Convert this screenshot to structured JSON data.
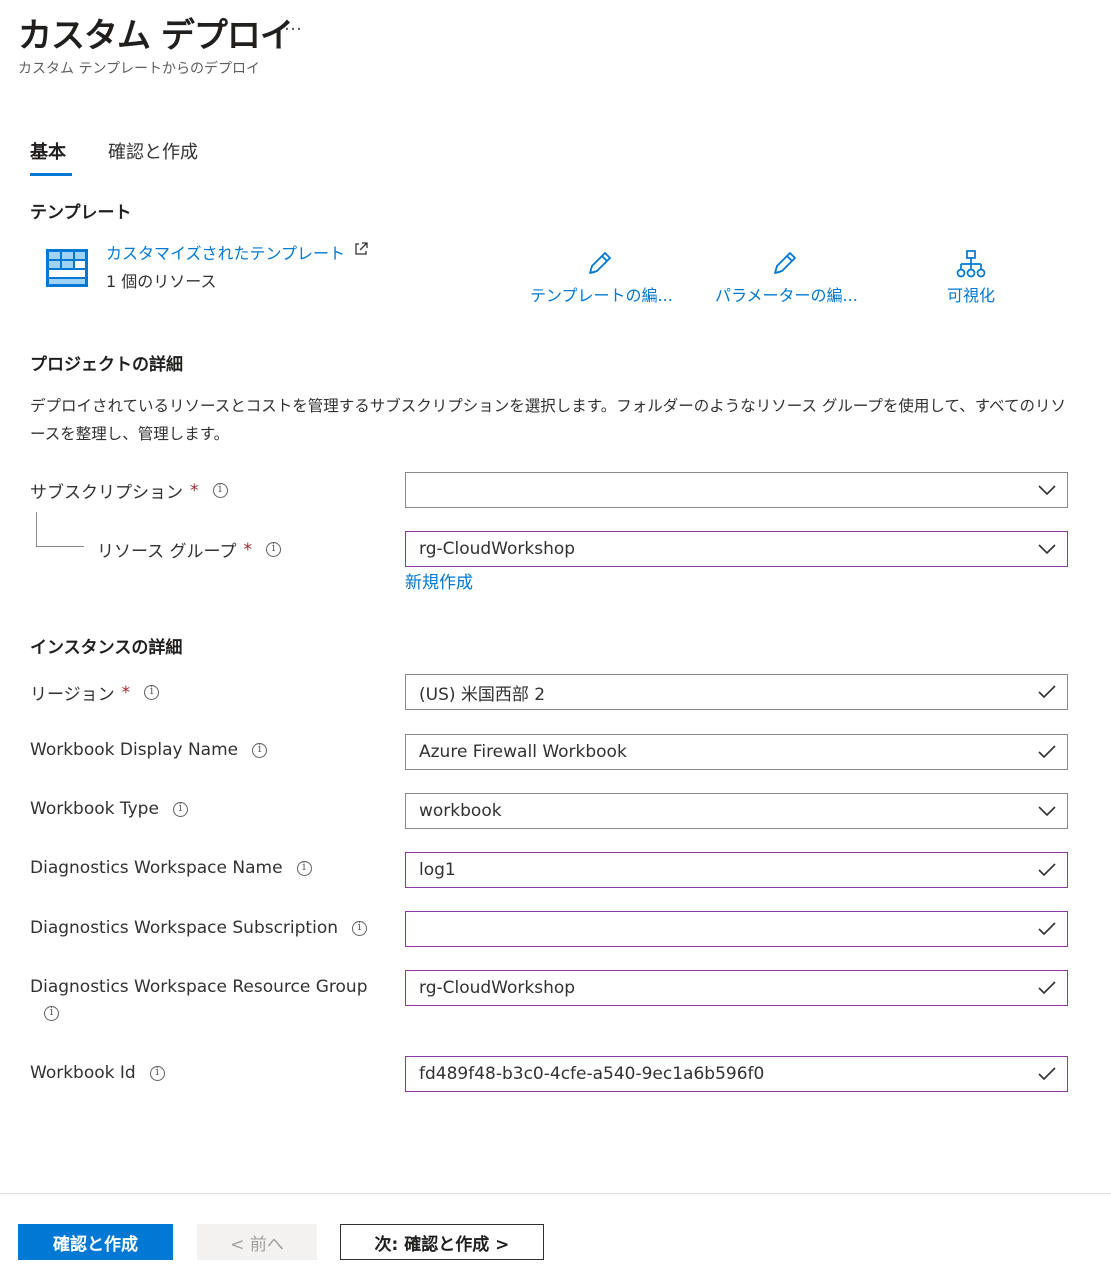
{
  "header": {
    "title": "カスタム デプロイ",
    "more": "…",
    "subtitle": "カスタム テンプレートからのデプロイ"
  },
  "tabs": [
    {
      "label": "基本",
      "active": true
    },
    {
      "label": "確認と作成",
      "active": false
    }
  ],
  "template_section": {
    "heading": "テンプレート",
    "link": "カスタマイズされたテンプレート",
    "resource_count": "1 個のリソース",
    "actions": [
      {
        "label": "テンプレートの編...",
        "icon": "pencil-icon"
      },
      {
        "label": "パラメーターの編...",
        "icon": "pencil-icon"
      },
      {
        "label": "可視化",
        "icon": "hierarchy-icon"
      }
    ]
  },
  "project_section": {
    "heading": "プロジェクトの詳細",
    "description": "デプロイされているリソースとコストを管理するサブスクリプションを選択します。フォルダーのようなリソース グループを使用して、すべてのリソースを整理し、管理します。",
    "subscription": {
      "label": "サブスクリプション",
      "required": "*",
      "value": ""
    },
    "resource_group": {
      "label": "リソース グループ",
      "required": "*",
      "value": "rg-CloudWorkshop"
    },
    "new_link": "新規作成"
  },
  "instance_section": {
    "heading": "インスタンスの詳細",
    "fields": [
      {
        "label": "リージョン",
        "required": "*",
        "value": "(US) 米国西部 2",
        "icon": "checkmark-icon"
      },
      {
        "label": "Workbook Display Name",
        "value": "Azure Firewall Workbook",
        "icon": "checkmark-icon"
      },
      {
        "label": "Workbook Type",
        "value": "workbook",
        "icon": "chevron-down-icon"
      },
      {
        "label": "Diagnostics Workspace Name",
        "value": "log1",
        "icon": "checkmark-icon"
      },
      {
        "label": "Diagnostics Workspace Subscription",
        "value": "",
        "icon": "checkmark-icon"
      },
      {
        "label": "Diagnostics Workspace Resource Group",
        "value": "rg-CloudWorkshop",
        "icon": "checkmark-icon"
      },
      {
        "label": "Workbook Id",
        "value": "fd489f48-b3c0-4cfe-a540-9ec1a6b596f0",
        "icon": "checkmark-icon"
      }
    ]
  },
  "footer": {
    "primary": "確認と作成",
    "previous": "< 前へ",
    "next": "次: 確認と作成 >"
  },
  "colors": {
    "accent": "#0078d4",
    "required": "#a4262c",
    "focus_border": "#8a3a9a"
  }
}
